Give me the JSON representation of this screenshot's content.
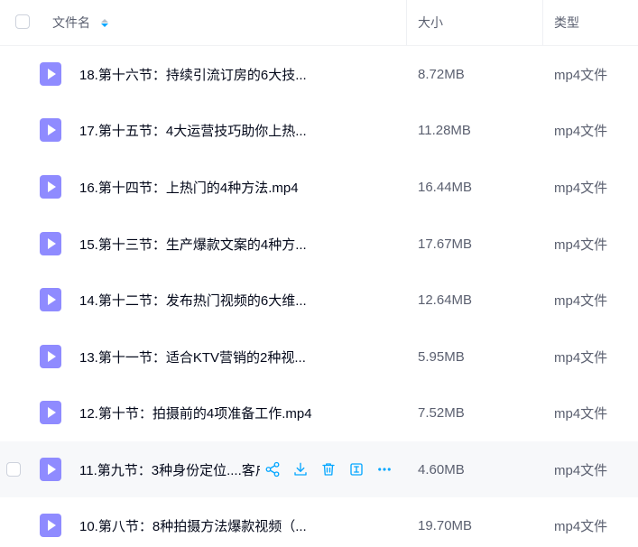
{
  "header": {
    "name_label": "文件名",
    "size_label": "大小",
    "type_label": "类型"
  },
  "files": [
    {
      "name": "18.第十六节：持续引流订房的6大技...",
      "size": "8.72MB",
      "type": "mp4文件"
    },
    {
      "name": "17.第十五节：4大运营技巧助你上热...",
      "size": "11.28MB",
      "type": "mp4文件"
    },
    {
      "name": "16.第十四节：上热门的4种方法.mp4",
      "size": "16.44MB",
      "type": "mp4文件"
    },
    {
      "name": "15.第十三节：生产爆款文案的4种方...",
      "size": "17.67MB",
      "type": "mp4文件"
    },
    {
      "name": "14.第十二节：发布热门视频的6大维...",
      "size": "12.64MB",
      "type": "mp4文件"
    },
    {
      "name": "13.第十一节：适合KTV营销的2种视...",
      "size": "5.95MB",
      "type": "mp4文件"
    },
    {
      "name": "12.第十节：拍摄前的4项准备工作.mp4",
      "size": "7.52MB",
      "type": "mp4文件"
    },
    {
      "name": "11.第九节：3种身份定位....客户",
      "size": "4.60MB",
      "type": "mp4文件"
    },
    {
      "name": "10.第八节：8种拍摄方法爆款视频（...",
      "size": "19.70MB",
      "type": "mp4文件"
    }
  ],
  "row_actions": [
    "share-icon",
    "download-icon",
    "delete-icon",
    "rename-icon",
    "more-icon"
  ],
  "colors": {
    "accent": "#06a7ff",
    "file_icon": "#8f8bff",
    "hover_row": "#f7f8fa"
  }
}
